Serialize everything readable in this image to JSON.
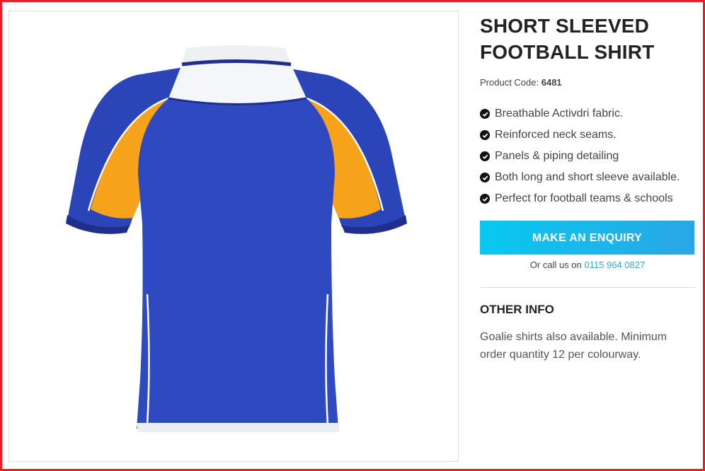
{
  "product": {
    "title_line1": "SHORT SLEEVED",
    "title_line2": "FOOTBALL SHIRT",
    "code_label": "Product Code:",
    "code_value": "6481",
    "image_alt": "Blue and orange short sleeved football shirt"
  },
  "features": [
    "Breathable Activdri fabric.",
    "Reinforced neck seams.",
    "Panels & piping detailing",
    "Both long and short sleeve available.",
    "Perfect for football teams & schools"
  ],
  "cta": {
    "enquiry_label": "MAKE AN ENQUIRY",
    "call_prefix": "Or call us on",
    "phone": "0115 964 0827"
  },
  "other_info": {
    "heading": "OTHER INFO",
    "text": "Goalie shirts also available. Minimum order quantity 12 per colourway."
  },
  "colors": {
    "frame_border": "#ee1c24",
    "shirt_blue": "#2b44b8",
    "shirt_orange": "#f7a21b",
    "button_start": "#08c9ef",
    "button_end": "#2aa6e6",
    "link": "#3aa8d8"
  },
  "icons": {
    "feature_bullet": "check-circle-icon"
  }
}
